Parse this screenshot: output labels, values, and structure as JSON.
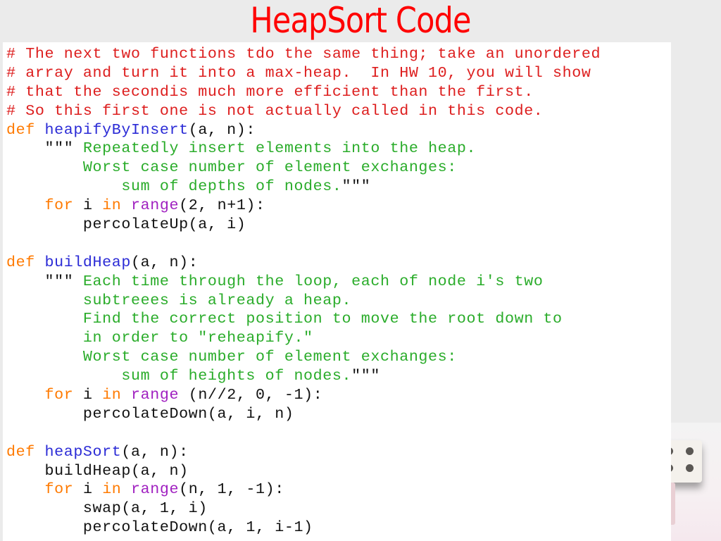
{
  "slide": {
    "title": "HeapSort Code"
  },
  "code": {
    "language": "python",
    "colors": {
      "comment": "#dd1e1e",
      "keyword": "#ff7a00",
      "function_name": "#2b2bd6",
      "builtin": "#a020c0",
      "docstring": "#2aac2a",
      "plain": "#111111",
      "title": "#ff0000"
    },
    "lines": [
      [
        {
          "t": "cmt",
          "s": "# The next two functions tdo the same thing; take an unordered"
        }
      ],
      [
        {
          "t": "cmt",
          "s": "# array and turn it into a max-heap.  In HW 10, you will show"
        }
      ],
      [
        {
          "t": "cmt",
          "s": "# that the secondis much more efficient than the first."
        }
      ],
      [
        {
          "t": "cmt",
          "s": "# So this first one is not actually called in this code."
        }
      ],
      [
        {
          "t": "kw",
          "s": "def "
        },
        {
          "t": "fn",
          "s": "heapifyByInsert"
        },
        {
          "t": "plain",
          "s": "(a, n):"
        }
      ],
      [
        {
          "t": "plain",
          "s": "    "
        },
        {
          "t": "plain",
          "s": "\"\"\" "
        },
        {
          "t": "str",
          "s": "Repeatedly insert elements into the heap."
        }
      ],
      [
        {
          "t": "str",
          "s": "        Worst case number of element exchanges:"
        }
      ],
      [
        {
          "t": "str",
          "s": "            sum of depths of nodes."
        },
        {
          "t": "plain",
          "s": "\"\"\""
        }
      ],
      [
        {
          "t": "plain",
          "s": "    "
        },
        {
          "t": "kw",
          "s": "for"
        },
        {
          "t": "plain",
          "s": " i "
        },
        {
          "t": "kw",
          "s": "in"
        },
        {
          "t": "plain",
          "s": " "
        },
        {
          "t": "bi",
          "s": "range"
        },
        {
          "t": "plain",
          "s": "(2, n+1):"
        }
      ],
      [
        {
          "t": "plain",
          "s": "        percolateUp(a, i)"
        }
      ],
      [
        {
          "t": "plain",
          "s": ""
        }
      ],
      [
        {
          "t": "kw",
          "s": "def "
        },
        {
          "t": "fn",
          "s": "buildHeap"
        },
        {
          "t": "plain",
          "s": "(a, n):"
        }
      ],
      [
        {
          "t": "plain",
          "s": "    "
        },
        {
          "t": "plain",
          "s": "\"\"\" "
        },
        {
          "t": "str",
          "s": "Each time through the loop, each of node i's two"
        }
      ],
      [
        {
          "t": "str",
          "s": "        subtreees is already a heap."
        }
      ],
      [
        {
          "t": "str",
          "s": "        Find the correct position to move the root down to"
        }
      ],
      [
        {
          "t": "str",
          "s": "        in order to \"reheapify.\""
        }
      ],
      [
        {
          "t": "str",
          "s": "        Worst case number of element exchanges:"
        }
      ],
      [
        {
          "t": "str",
          "s": "            sum of heights of nodes."
        },
        {
          "t": "plain",
          "s": "\"\"\""
        }
      ],
      [
        {
          "t": "plain",
          "s": "    "
        },
        {
          "t": "kw",
          "s": "for"
        },
        {
          "t": "plain",
          "s": " i "
        },
        {
          "t": "kw",
          "s": "in"
        },
        {
          "t": "plain",
          "s": " "
        },
        {
          "t": "bi",
          "s": "range"
        },
        {
          "t": "plain",
          "s": " (n//2, 0, -1):"
        }
      ],
      [
        {
          "t": "plain",
          "s": "        percolateDown(a, i, n)"
        }
      ],
      [
        {
          "t": "plain",
          "s": ""
        }
      ],
      [
        {
          "t": "kw",
          "s": "def "
        },
        {
          "t": "fn",
          "s": "heapSort"
        },
        {
          "t": "plain",
          "s": "(a, n):"
        }
      ],
      [
        {
          "t": "plain",
          "s": "    buildHeap(a, n)"
        }
      ],
      [
        {
          "t": "plain",
          "s": "    "
        },
        {
          "t": "kw",
          "s": "for"
        },
        {
          "t": "plain",
          "s": " i "
        },
        {
          "t": "kw",
          "s": "in"
        },
        {
          "t": "plain",
          "s": " "
        },
        {
          "t": "bi",
          "s": "range"
        },
        {
          "t": "plain",
          "s": "(n, 1, -1):"
        }
      ],
      [
        {
          "t": "plain",
          "s": "        swap(a, 1, i)"
        }
      ],
      [
        {
          "t": "plain",
          "s": "        percolateDown(a, 1, i-1)"
        }
      ]
    ]
  },
  "decoration": {
    "image": "dice-icon"
  }
}
